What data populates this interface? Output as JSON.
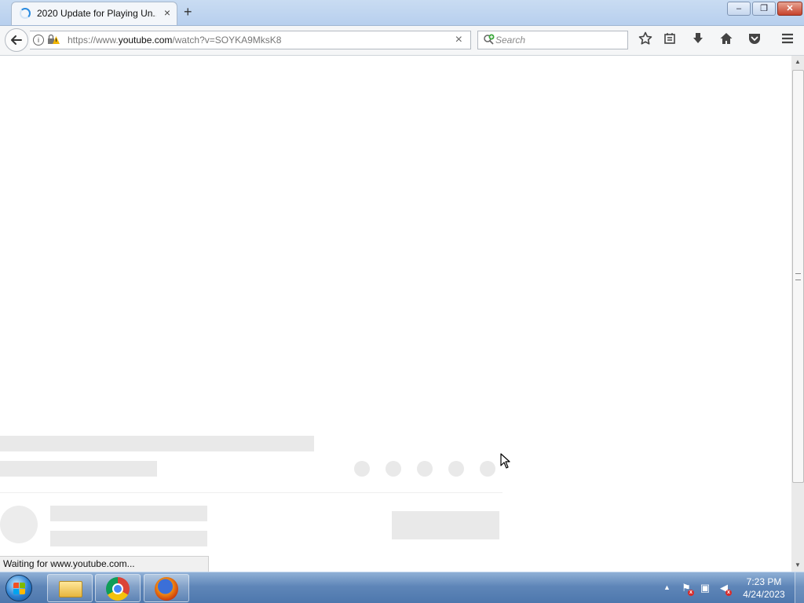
{
  "browser": {
    "tab": {
      "title": "2020 Update for Playing Un...",
      "close_glyph": "×"
    },
    "new_tab_glyph": "+",
    "window_controls": {
      "minimize": "–",
      "maximize": "❐",
      "close": "✕"
    }
  },
  "navbar": {
    "url": {
      "prefix": "https://www.",
      "host": "youtube.com",
      "path": "/watch?v=SOYKA9MksK8"
    },
    "url_clear_glyph": "×",
    "search": {
      "placeholder": "Search",
      "value": ""
    }
  },
  "status_bar": {
    "text": "Waiting for www.youtube.com..."
  },
  "taskbar": {
    "clock": {
      "time": "7:23 PM",
      "date": "4/24/2023"
    },
    "tray_arrow": "▲"
  },
  "colors": {
    "accent": "#2a8be0",
    "placeholder": "#e9e9e9",
    "taskbar": "#5f86b8"
  },
  "icons": {
    "bookmark": "bookmark-star-icon",
    "reading_list": "reading-list-icon",
    "downloads": "downloads-icon",
    "home": "home-icon",
    "pocket": "pocket-icon",
    "menu": "menu-icon"
  }
}
